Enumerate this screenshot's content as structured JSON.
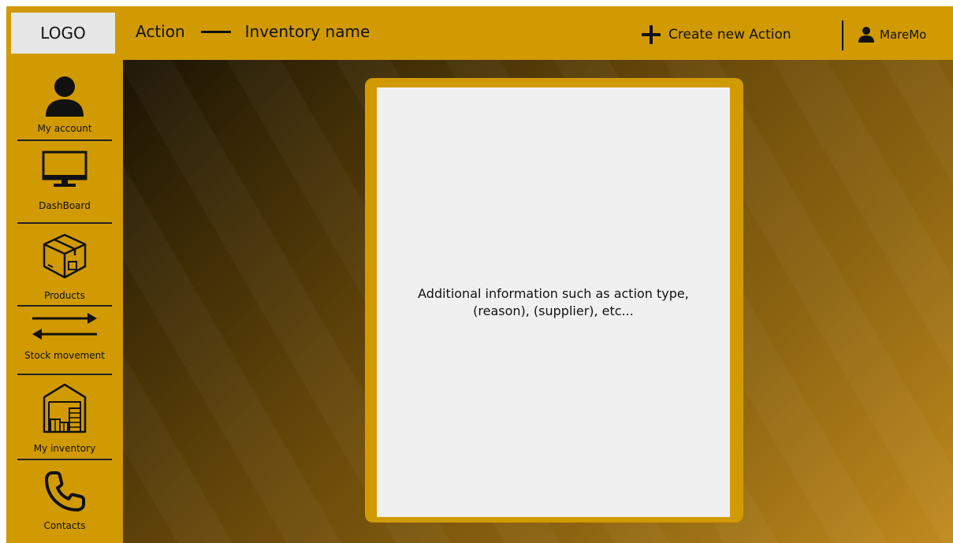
{
  "header": {
    "logo": "LOGO",
    "title_left": "Action",
    "title_right": "Inventory name",
    "create_label": "Create new Action",
    "username": "MareMo"
  },
  "sidebar": {
    "items": [
      {
        "label": "My account",
        "icon": "user-icon"
      },
      {
        "label": "DashBoard",
        "icon": "monitor-icon"
      },
      {
        "label": "Products",
        "icon": "box-icon"
      },
      {
        "label": "Stock movement",
        "icon": "arrows-icon"
      },
      {
        "label": "My inventory",
        "icon": "warehouse-icon"
      },
      {
        "label": "Contacts",
        "icon": "phone-icon"
      }
    ]
  },
  "card": {
    "line1": "Additional information such as action type,",
    "line2": "(reason), (supplier), etc..."
  },
  "colors": {
    "accent": "#d19a00",
    "card_bg": "#f1f0f0"
  }
}
